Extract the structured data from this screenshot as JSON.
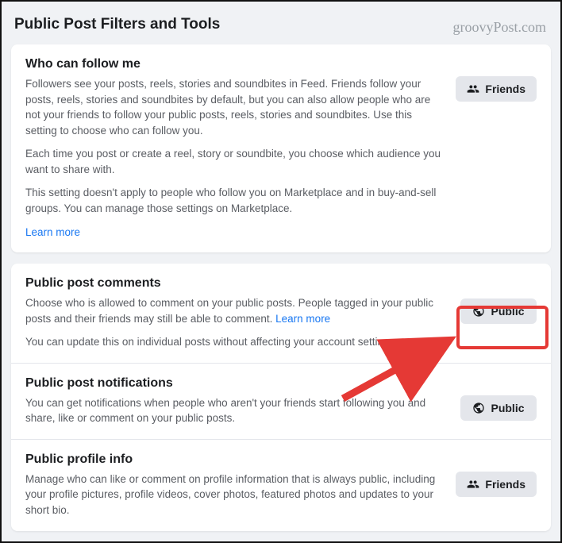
{
  "watermark": "groovyPost.com",
  "page_title": "Public Post Filters and Tools",
  "follow": {
    "title": "Who can follow me",
    "p1": "Followers see your posts, reels, stories and soundbites in Feed. Friends follow your posts, reels, stories and soundbites by default, but you can also allow people who are not your friends to follow your public posts, reels, stories and soundbites. Use this setting to choose who can follow you.",
    "p2": "Each time you post or create a reel, story or soundbite, you choose which audience you want to share with.",
    "p3": "This setting doesn't apply to people who follow you on Marketplace and in buy-and-sell groups. You can manage those settings on Marketplace.",
    "learn_more": "Learn more",
    "button_label": "Friends",
    "button_icon": "friends-icon"
  },
  "comments": {
    "title": "Public post comments",
    "p1_a": "Choose who is allowed to comment on your public posts. People tagged in your public posts and their friends may still be able to comment. ",
    "learn_more": "Learn more",
    "p2": "You can update this on individual posts without affecting your account settings.",
    "button_label": "Public",
    "button_icon": "globe-icon"
  },
  "notifications": {
    "title": "Public post notifications",
    "p1": "You can get notifications when people who aren't your friends start following you and share, like or comment on your public posts.",
    "button_label": "Public",
    "button_icon": "globe-icon"
  },
  "profile": {
    "title": "Public profile info",
    "p1": "Manage who can like or comment on profile information that is always public, including your profile pictures, profile videos, cover photos, featured photos and updates to your short bio.",
    "button_label": "Friends",
    "button_icon": "friends-icon"
  },
  "annotation": {
    "highlight_color": "#e53935"
  }
}
